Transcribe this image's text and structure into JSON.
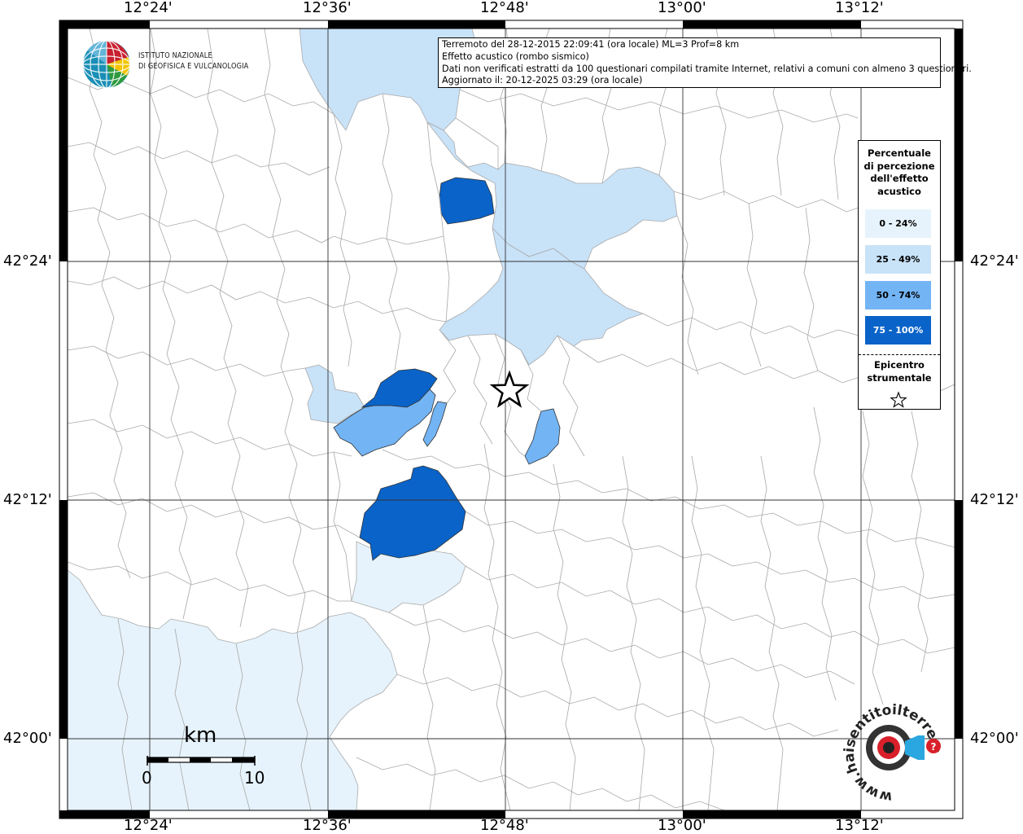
{
  "info": {
    "line1": "Terremoto del 28-12-2015 22:09:41 (ora locale) ML=3 Prof=8 km",
    "line2": "Effetto acustico (rombo sismico)",
    "line3": "Dati non verificati estratti da 100 questionari compilati tramite Internet, relativi a comuni con almeno 3 questionari.",
    "line4": "Aggiornato il: 20-12-2025 03:29 (ora locale)"
  },
  "institute": {
    "line1": "ISTITUTO NAZIONALE",
    "line2": "DI GEOFISICA E VULCANOLOGIA"
  },
  "legend": {
    "title_lines": [
      "Percentuale",
      "di percezione",
      "dell'effetto",
      "acustico"
    ],
    "classes": [
      {
        "label": "0 - 24%",
        "color": "#e6f3fc"
      },
      {
        "label": "25 - 49%",
        "color": "#c8e2f8"
      },
      {
        "label": "50 - 74%",
        "color": "#73b4f4"
      },
      {
        "label": "75 - 100%",
        "color": "#0a63c8"
      }
    ],
    "epicenter_lines": [
      "Epicentro",
      "strumentale"
    ]
  },
  "axes": {
    "longitudes": [
      "12°24'",
      "12°36'",
      "12°48'",
      "13°00'",
      "13°12'"
    ],
    "latitudes": [
      "42°24'",
      "42°12'",
      "42°00'"
    ]
  },
  "scale": {
    "unit": "km",
    "start": "0",
    "end": "10"
  },
  "brand": {
    "text": "www.haisentitoilterremoto.it"
  }
}
